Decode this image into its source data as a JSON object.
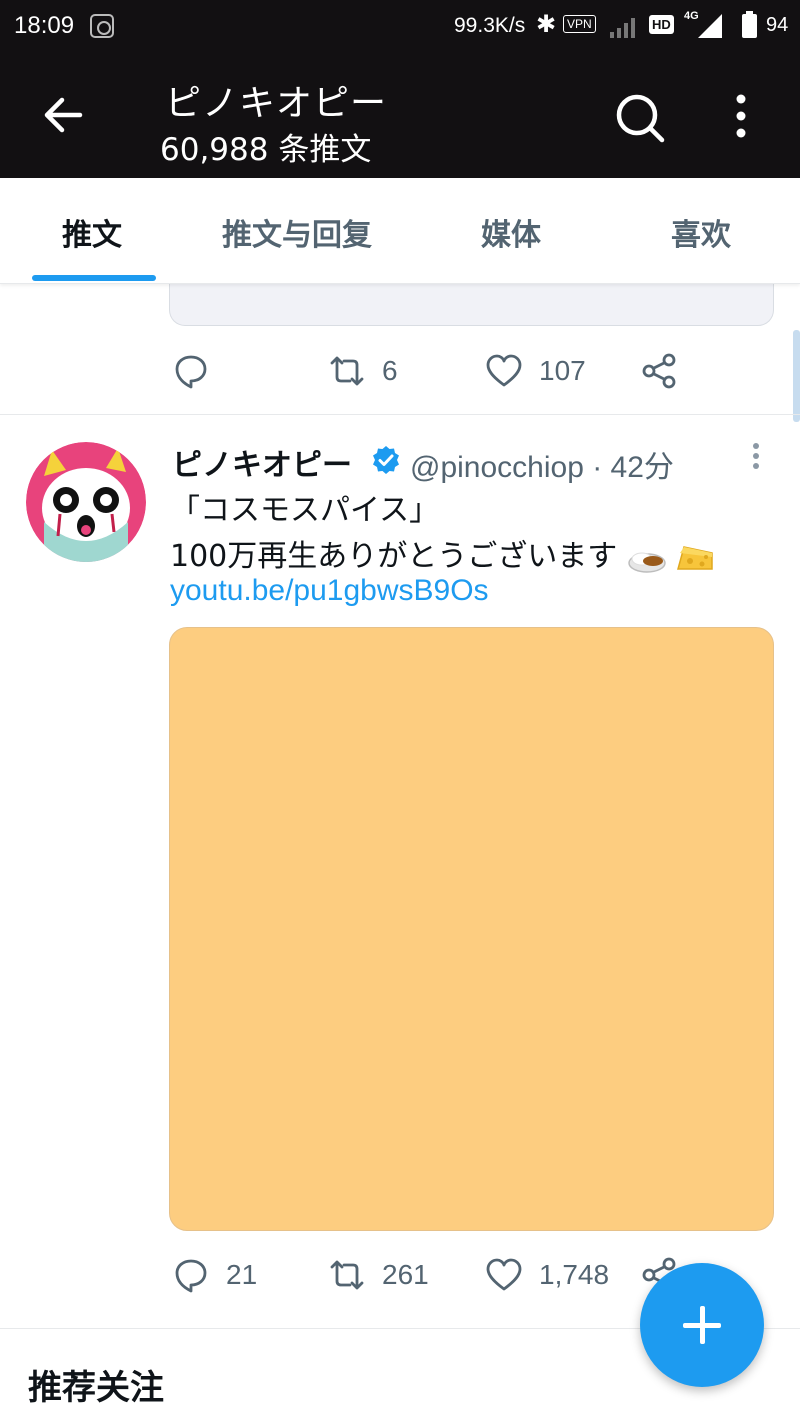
{
  "status_bar": {
    "time": "18:09",
    "net_speed": "99.3K/s",
    "vpn": "VPN",
    "hd": "HD",
    "network": "4G",
    "battery": "94"
  },
  "header": {
    "title": "ピノキオピー",
    "subtitle": "60,988 条推文"
  },
  "tabs": [
    {
      "label": "推文",
      "active": true
    },
    {
      "label": "推文与回复",
      "active": false
    },
    {
      "label": "媒体",
      "active": false
    },
    {
      "label": "喜欢",
      "active": false
    }
  ],
  "prev_tweet": {
    "retweets": "6",
    "likes": "107"
  },
  "tweet": {
    "name": "ピノキオピー",
    "handle_time": "@pinocchiop · 42分",
    "line1": "「コスモスパイス」",
    "line2": "100万再生ありがとうございます",
    "link": "youtu.be/pu1gbwsB9Os",
    "replies": "21",
    "retweets": "261",
    "likes": "1,748",
    "media_color": "#fdcd80"
  },
  "section": {
    "title": "推荐关注"
  },
  "colors": {
    "accent": "#1d9bf0",
    "header_bg": "#121012",
    "avatar_bg": "#e8437c"
  }
}
